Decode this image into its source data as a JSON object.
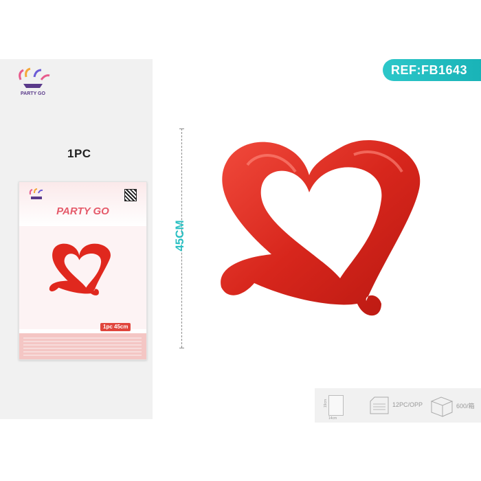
{
  "brand": "PARTY GO",
  "quantity_label": "1PC",
  "reference": "REF:FB1643",
  "height_label": "45CM",
  "package": {
    "brand": "PARTY GO",
    "size_badge": "1pc 45cm"
  },
  "specs": {
    "card_width": "14cm",
    "card_height": "19cm",
    "opp_pack": "12PC/OPP",
    "carton": "600/箱"
  },
  "colors": {
    "accent": "#2bc0c3",
    "balloon": "#e0281e",
    "panel": "#f1f1f1"
  }
}
